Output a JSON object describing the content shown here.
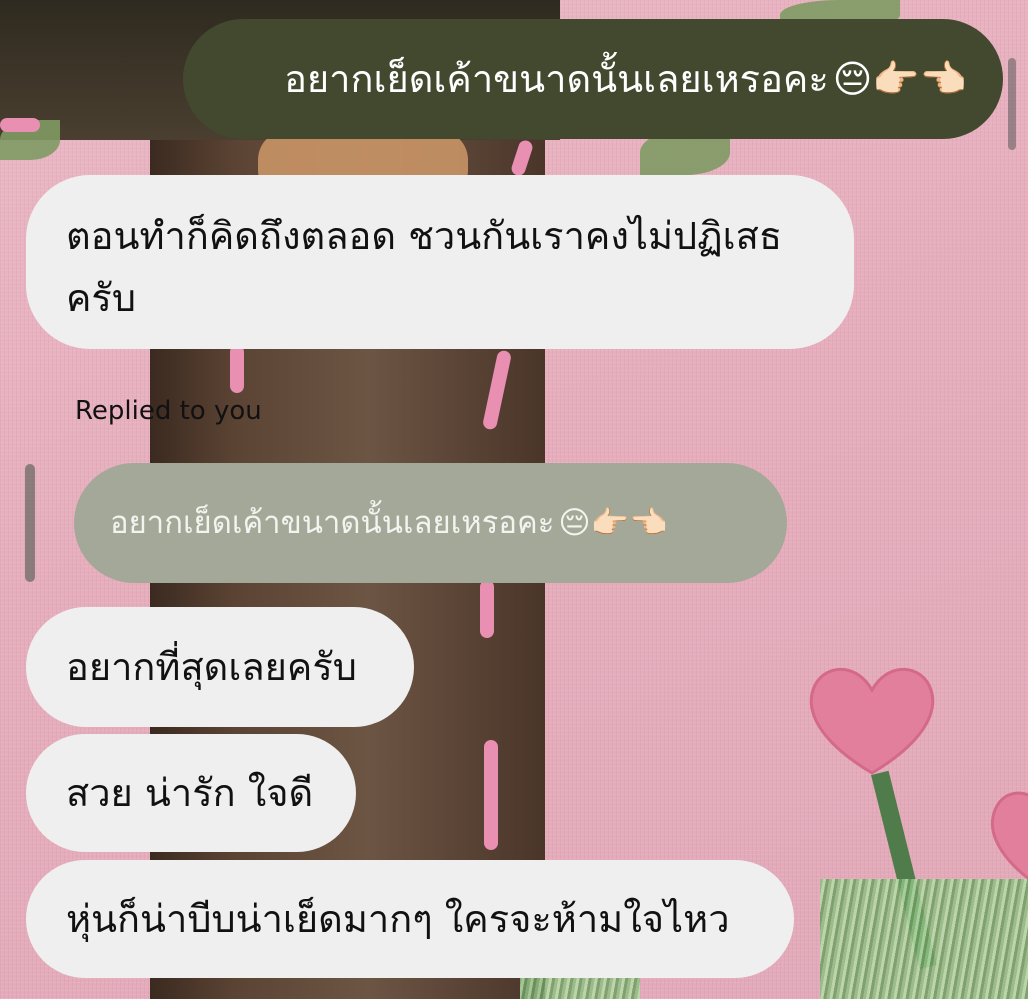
{
  "conversation": {
    "sent_message": {
      "text": "อยากเย็ดเค้าขนาดนั้นเลยเหรอคะ",
      "emojis": "😔👉🏻👈🏻"
    },
    "received_1": "ตอนทำก็คิดถึงตลอด ชวนกันเราคงไม่ปฏิเสธครับ",
    "reply_context": {
      "label": "Replied to you",
      "quoted_text": "อยากเย็ดเค้าขนาดนั้นเลยเหรอคะ",
      "quoted_emojis": "😔👉🏻👈🏻"
    },
    "received_2": "อยากที่สุดเลยครับ",
    "received_3": "สวย น่ารัก ใจดี",
    "received_4": "หุ่นก็น่าบีบน่าเย็ดมากๆ ใครจะห้ามใจไหว"
  },
  "colors": {
    "sent_bubble": "#43492f",
    "received_bubble": "#efefef",
    "quoted_bubble": "#a4a898",
    "background": "#e9b5c2"
  }
}
